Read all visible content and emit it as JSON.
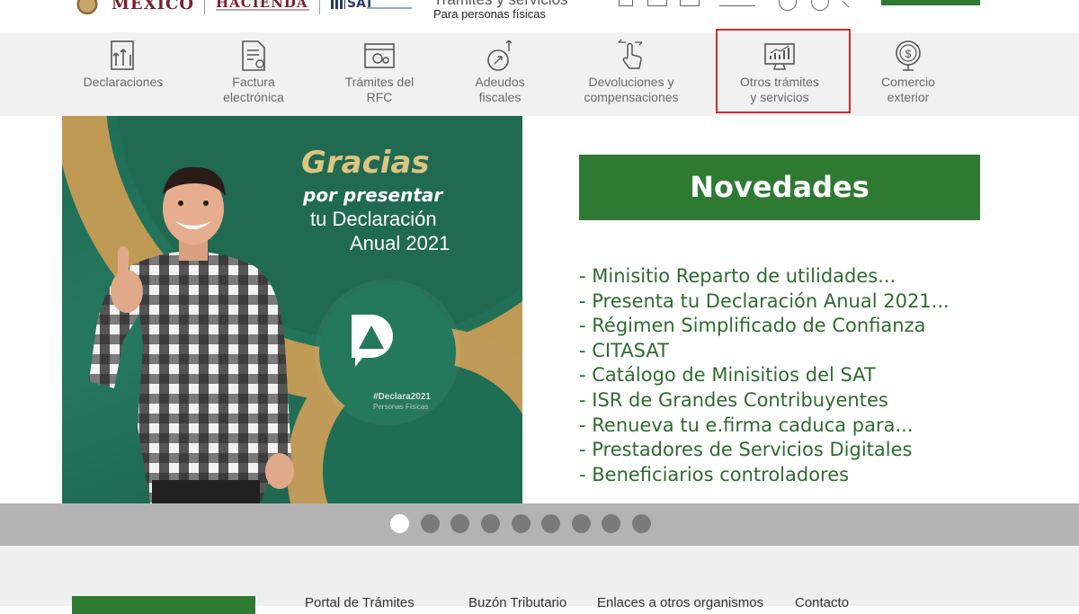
{
  "header": {
    "logo_mexico": "MÉXICO",
    "logo_hacienda": "HACIENDA",
    "logo_sat": "SAT",
    "portal_title": "Trámites y servicios",
    "portal_subtitle": "Para personas físicas"
  },
  "nav": {
    "items": [
      {
        "label": "Declaraciones",
        "icon": "declaraciones-icon"
      },
      {
        "label": "Factura\nelectrónica",
        "icon": "factura-icon"
      },
      {
        "label": "Trámites del\nRFC",
        "icon": "rfc-icon"
      },
      {
        "label": "Adeudos\nfiscales",
        "icon": "adeudos-icon"
      },
      {
        "label": "Devoluciones y\ncompensaciones",
        "icon": "devoluciones-icon"
      },
      {
        "label": "Otros trámites\ny servicios",
        "icon": "otros-tramites-icon"
      },
      {
        "label": "Comercio\nexterior",
        "icon": "comercio-icon"
      }
    ],
    "highlighted_item": "Otros trámites\ny servicios",
    "highlight_color": "#d42a2a"
  },
  "banner": {
    "title": "Gracias",
    "line2": "por presentar",
    "line3": "tu Declaración",
    "line4": "Anual 2021",
    "hashtag": "#Declara2021",
    "badge_sub": "Personas Físicas",
    "colors": {
      "green": "#1f6d55",
      "gold": "#c09a58"
    }
  },
  "novedades": {
    "title": "Novedades",
    "items": [
      "- Minisitio Reparto de utilidades...",
      "- Presenta tu Declaración Anual 2021...",
      "- Régimen Simplificado de Confianza",
      "- CITASAT",
      "- Catálogo de Minisitios del SAT",
      "- ISR de Grandes Contribuyentes",
      "- Renueva tu e.firma caduca para...",
      "- Prestadores de Servicios Digitales",
      "- Beneficiarios controladores"
    ],
    "accent": "#2f7a32"
  },
  "carousel": {
    "slide_count": 9,
    "active_index": 0
  },
  "footer": {
    "links": [
      "Portal de Trámites",
      "Buzón Tributario",
      "Enlaces a otros organismos",
      "Contacto"
    ]
  }
}
